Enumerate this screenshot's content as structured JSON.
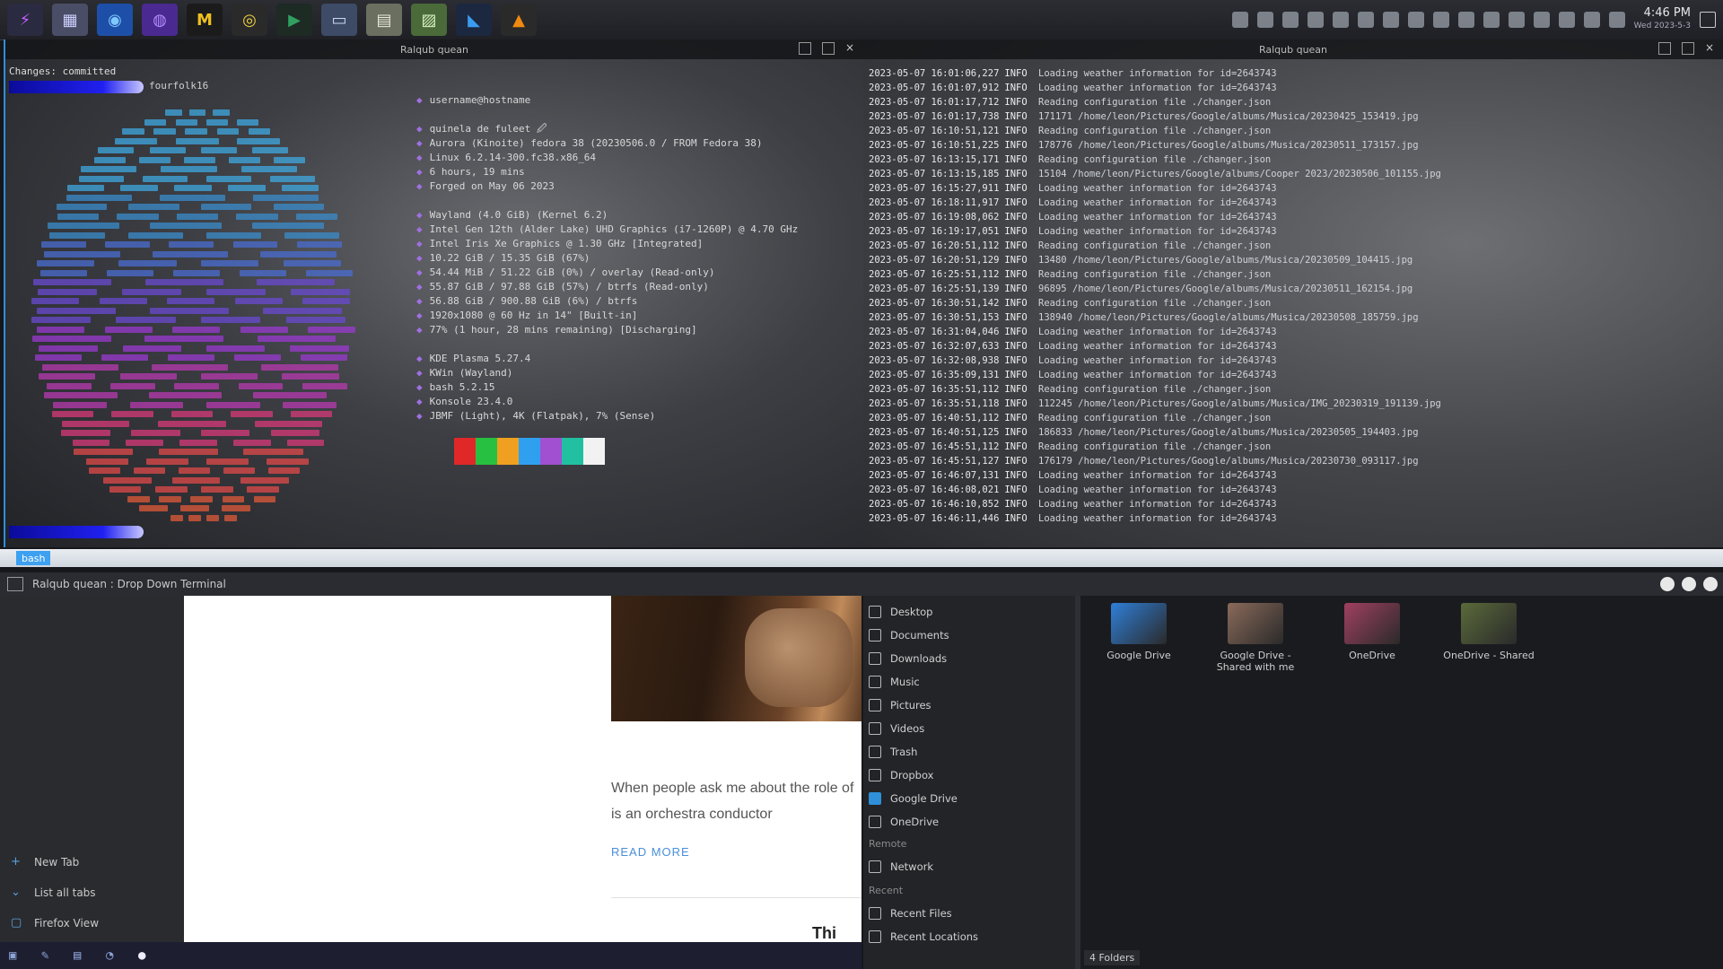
{
  "taskbar": {
    "apps": [
      {
        "name": "kde-icon",
        "glyph": "⚡",
        "bg": "#2a2a40",
        "fg": "#c060ff"
      },
      {
        "name": "pager-icon",
        "glyph": "▦",
        "bg": "#4a4d66",
        "fg": "#d0d0ff"
      },
      {
        "name": "browser-icon",
        "glyph": "◉",
        "bg": "#1e4fa8",
        "fg": "#7ec8ff"
      },
      {
        "name": "mastodon-icon",
        "glyph": "◍",
        "bg": "#4a2a90",
        "fg": "#b48cff"
      },
      {
        "name": "m-app-icon",
        "glyph": "M",
        "bg": "#1b1b1b",
        "fg": "#f0c020"
      },
      {
        "name": "chrome-icon",
        "glyph": "◎",
        "bg": "#2a2a2a",
        "fg": "#f0d040"
      },
      {
        "name": "terminal-app-icon",
        "glyph": "▶",
        "bg": "#1e2a24",
        "fg": "#2fa060"
      },
      {
        "name": "window-icon",
        "glyph": "▭",
        "bg": "#3d4b66",
        "fg": "#cdd8f0"
      },
      {
        "name": "calculator-icon",
        "glyph": "▤",
        "bg": "#6a6f60",
        "fg": "#e8e8d8"
      },
      {
        "name": "image-viewer-icon",
        "glyph": "▨",
        "bg": "#4a6a3a",
        "fg": "#d8f0c0"
      },
      {
        "name": "vscode-icon",
        "glyph": "◣",
        "bg": "#1b2840",
        "fg": "#3a9bf0"
      },
      {
        "name": "vlc-icon",
        "glyph": "▲",
        "bg": "#2a2a2a",
        "fg": "#f08a10"
      }
    ],
    "tray_count": 16,
    "clock": "4:46 PM",
    "date": "Wed 2023-5-3"
  },
  "terminal_left": {
    "title": "Ralqub quean",
    "top_line": "Changes: committed",
    "cwd_label": "fourfolk16",
    "info_lines": [
      {
        "k": "◆",
        "v": "username@hostname"
      },
      {
        "k": "",
        "v": ""
      },
      {
        "k": "◆",
        "v": "quinela de fuleet 🖉"
      },
      {
        "k": "◆",
        "v": "Aurora (Kinoite) fedora 38 (20230506.0 / FROM Fedora 38)"
      },
      {
        "k": "◆",
        "v": "Linux 6.2.14-300.fc38.x86_64"
      },
      {
        "k": "◆",
        "v": "6 hours, 19 mins"
      },
      {
        "k": "◆",
        "v": "Forged on May 06 2023"
      },
      {
        "k": "",
        "v": ""
      },
      {
        "k": "◆",
        "v": "Wayland (4.0 GiB) (Kernel 6.2)"
      },
      {
        "k": "◆",
        "v": "Intel Gen 12th (Alder Lake) UHD Graphics (i7-1260P) @ 4.70 GHz"
      },
      {
        "k": "◆",
        "v": "Intel Iris Xe Graphics @ 1.30 GHz [Integrated]"
      },
      {
        "k": "◆",
        "v": "10.22 GiB / 15.35 GiB (67%)"
      },
      {
        "k": "◆",
        "v": "54.44 MiB / 51.22 GiB (0%) / overlay (Read-only)"
      },
      {
        "k": "◆",
        "v": "55.87 GiB / 97.88 GiB (57%) / btrfs (Read-only)"
      },
      {
        "k": "◆",
        "v": "56.88 GiB / 900.88 GiB (6%) / btrfs"
      },
      {
        "k": "◆",
        "v": "1920x1080 @ 60 Hz in 14\" [Built-in]"
      },
      {
        "k": "◆",
        "v": "77% (1 hour, 28 mins remaining) [Discharging]"
      },
      {
        "k": "",
        "v": ""
      },
      {
        "k": "◆",
        "v": "KDE Plasma 5.27.4"
      },
      {
        "k": "◆",
        "v": "KWin (Wayland)"
      },
      {
        "k": "◆",
        "v": "bash 5.2.15"
      },
      {
        "k": "◆",
        "v": "Konsole 23.4.0"
      },
      {
        "k": "◆",
        "v": "JBMF (Light), 4K (Flatpak), 7% (Sense)"
      }
    ],
    "swatches": [
      "#e02828",
      "#28c040",
      "#f0a020",
      "#2fa0f0",
      "#a050d0",
      "#20c0a0",
      "#f2f2f2"
    ]
  },
  "terminal_right": {
    "title": "Ralqub quean",
    "log": [
      {
        "ts": "2023-05-07 16:01:06,227",
        "lvl": "INFO",
        "msg": "Loading weather information for id=2643743"
      },
      {
        "ts": "2023-05-07 16:01:07,912",
        "lvl": "INFO",
        "msg": "Loading weather information for id=2643743"
      },
      {
        "ts": "2023-05-07 16:01:17,712",
        "lvl": "INFO",
        "msg": "Reading configuration file ./changer.json"
      },
      {
        "ts": "2023-05-07 16:01:17,738",
        "lvl": "INFO",
        "msg": "171171 /home/leon/Pictures/Google/albums/Musica/20230425_153419.jpg"
      },
      {
        "ts": "2023-05-07 16:10:51,121",
        "lvl": "INFO",
        "msg": "Reading configuration file ./changer.json"
      },
      {
        "ts": "2023-05-07 16:10:51,225",
        "lvl": "INFO",
        "msg": "178776 /home/leon/Pictures/Google/albums/Musica/20230511_173157.jpg"
      },
      {
        "ts": "2023-05-07 16:13:15,171",
        "lvl": "INFO",
        "msg": "Reading configuration file ./changer.json"
      },
      {
        "ts": "2023-05-07 16:13:15,185",
        "lvl": "INFO",
        "msg": "15104 /home/leon/Pictures/Google/albums/Cooper 2023/20230506_101155.jpg"
      },
      {
        "ts": "2023-05-07 16:15:27,911",
        "lvl": "INFO",
        "msg": "Loading weather information for id=2643743"
      },
      {
        "ts": "2023-05-07 16:18:11,917",
        "lvl": "INFO",
        "msg": "Loading weather information for id=2643743"
      },
      {
        "ts": "2023-05-07 16:19:08,062",
        "lvl": "INFO",
        "msg": "Loading weather information for id=2643743"
      },
      {
        "ts": "2023-05-07 16:19:17,051",
        "lvl": "INFO",
        "msg": "Loading weather information for id=2643743"
      },
      {
        "ts": "2023-05-07 16:20:51,112",
        "lvl": "INFO",
        "msg": "Reading configuration file ./changer.json"
      },
      {
        "ts": "2023-05-07 16:20:51,129",
        "lvl": "INFO",
        "msg": "13480 /home/leon/Pictures/Google/albums/Musica/20230509_104415.jpg"
      },
      {
        "ts": "2023-05-07 16:25:51,112",
        "lvl": "INFO",
        "msg": "Reading configuration file ./changer.json"
      },
      {
        "ts": "2023-05-07 16:25:51,139",
        "lvl": "INFO",
        "msg": "96895 /home/leon/Pictures/Google/albums/Musica/20230511_162154.jpg"
      },
      {
        "ts": "2023-05-07 16:30:51,142",
        "lvl": "INFO",
        "msg": "Reading configuration file ./changer.json"
      },
      {
        "ts": "2023-05-07 16:30:51,153",
        "lvl": "INFO",
        "msg": "138940 /home/leon/Pictures/Google/albums/Musica/20230508_185759.jpg"
      },
      {
        "ts": "2023-05-07 16:31:04,046",
        "lvl": "INFO",
        "msg": "Loading weather information for id=2643743"
      },
      {
        "ts": "2023-05-07 16:32:07,633",
        "lvl": "INFO",
        "msg": "Loading weather information for id=2643743"
      },
      {
        "ts": "2023-05-07 16:32:08,938",
        "lvl": "INFO",
        "msg": "Loading weather information for id=2643743"
      },
      {
        "ts": "2023-05-07 16:35:09,131",
        "lvl": "INFO",
        "msg": "Loading weather information for id=2643743"
      },
      {
        "ts": "2023-05-07 16:35:51,112",
        "lvl": "INFO",
        "msg": "Reading configuration file ./changer.json"
      },
      {
        "ts": "2023-05-07 16:35:51,118",
        "lvl": "INFO",
        "msg": "112245 /home/leon/Pictures/Google/albums/Musica/IMG_20230319_191139.jpg"
      },
      {
        "ts": "2023-05-07 16:40:51,112",
        "lvl": "INFO",
        "msg": "Reading configuration file ./changer.json"
      },
      {
        "ts": "2023-05-07 16:40:51,125",
        "lvl": "INFO",
        "msg": "186833 /home/leon/Pictures/Google/albums/Musica/20230505_194403.jpg"
      },
      {
        "ts": "2023-05-07 16:45:51,112",
        "lvl": "INFO",
        "msg": "Reading configuration file ./changer.json"
      },
      {
        "ts": "2023-05-07 16:45:51,127",
        "lvl": "INFO",
        "msg": "176179 /home/leon/Pictures/Google/albums/Musica/20230730_093117.jpg"
      },
      {
        "ts": "2023-05-07 16:46:07,131",
        "lvl": "INFO",
        "msg": "Loading weather information for id=2643743"
      },
      {
        "ts": "2023-05-07 16:46:08,021",
        "lvl": "INFO",
        "msg": "Loading weather information for id=2643743"
      },
      {
        "ts": "2023-05-07 16:46:10,852",
        "lvl": "INFO",
        "msg": "Loading weather information for id=2643743"
      },
      {
        "ts": "2023-05-07 16:46:11,446",
        "lvl": "INFO",
        "msg": "Loading weather information for id=2643743"
      }
    ]
  },
  "dropdown": {
    "tab_label": "bash",
    "window_title": "Ralqub quean : Drop Down Terminal"
  },
  "browser": {
    "sidebar_items": [
      {
        "icon": "+",
        "label": "New Tab"
      },
      {
        "icon": "⌄",
        "label": "List all tabs"
      },
      {
        "icon": "▢",
        "label": "Firefox View"
      }
    ],
    "blurb": "When people ask me about the role of is an orchestra conductor",
    "read_more": "READ MORE",
    "partial_heading": "Thi"
  },
  "files": {
    "places": [
      {
        "label": "Desktop"
      },
      {
        "label": "Documents"
      },
      {
        "label": "Downloads"
      },
      {
        "label": "Music"
      },
      {
        "label": "Pictures"
      },
      {
        "label": "Videos"
      },
      {
        "label": "Trash"
      },
      {
        "label": "Dropbox"
      },
      {
        "label": "Google Drive",
        "selected": true
      },
      {
        "label": "OneDrive"
      }
    ],
    "remote_header": "Remote",
    "remote_items": [
      {
        "label": "Network"
      }
    ],
    "recent_header": "Recent",
    "recent_items": [
      {
        "label": "Recent Files"
      },
      {
        "label": "Recent Locations"
      }
    ],
    "folders": [
      {
        "label": "Google Drive",
        "color": "#2f7fd8"
      },
      {
        "label": "Google Drive - Shared with me",
        "color": "#8a6a5a"
      },
      {
        "label": "OneDrive",
        "color": "#a04060"
      },
      {
        "label": "OneDrive - Shared",
        "color": "#5a6a3a"
      }
    ],
    "status": "4 Folders"
  }
}
